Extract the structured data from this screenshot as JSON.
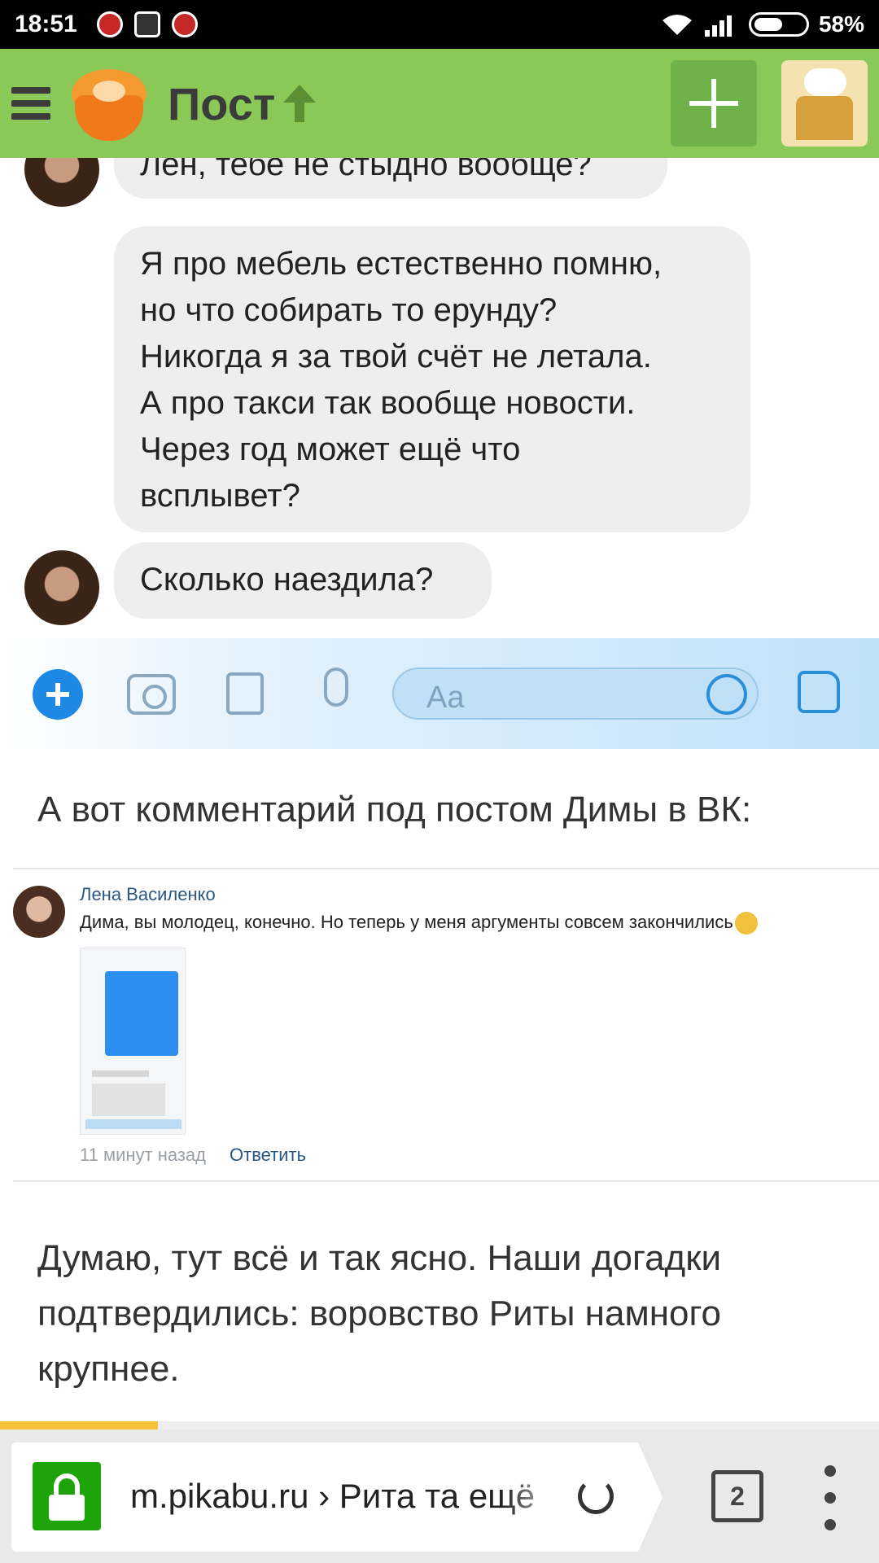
{
  "status_bar": {
    "time": "18:51",
    "battery": "58%"
  },
  "app_bar": {
    "title": "Пост"
  },
  "chat": {
    "cut_message": "Лен, тебе не стыдно вообще?",
    "message_lines": [
      "Я про мебель естественно помню,",
      "но что собирать то ерунду?",
      "Никогда я за твой счёт не летала.",
      "А про такси так вообще новости.",
      "Через год может ещё что",
      "всплывет?"
    ],
    "last_message": "Сколько наездила?",
    "composer_placeholder": "Aa"
  },
  "post": {
    "intro_text": "А вот комментарий под постом Димы в ВК:",
    "comment": {
      "author": "Лена Василенко",
      "text": "Дима, вы молодец, конечно. Но теперь у меня аргументы совсем закончились",
      "time": "11 минут назад",
      "reply": "Ответить"
    },
    "conclusion_text": "Думаю, тут всё и так ясно. Наши догадки подтвердились: воровство Риты намного крупнее.",
    "read_progress": 0.18
  },
  "browser": {
    "url": "m.pikabu.ru › Рита та ещё",
    "tab_count": "2"
  },
  "colors": {
    "app_bar": "#8ac858",
    "link": "#2a5885",
    "messenger_blue": "#1e88e5",
    "secure_lock": "#1ea30b",
    "progress": "#f7c23a"
  },
  "icons": [
    "menu-icon",
    "pikabu-logo",
    "arrow-up-icon",
    "plus-icon",
    "profile-avatar",
    "wifi-icon",
    "signal-icon",
    "battery-icon",
    "camera-icon",
    "image-icon",
    "microphone-icon",
    "emoji-icon",
    "thumbs-up-icon",
    "lock-icon",
    "reload-icon",
    "more-vert-icon"
  ]
}
